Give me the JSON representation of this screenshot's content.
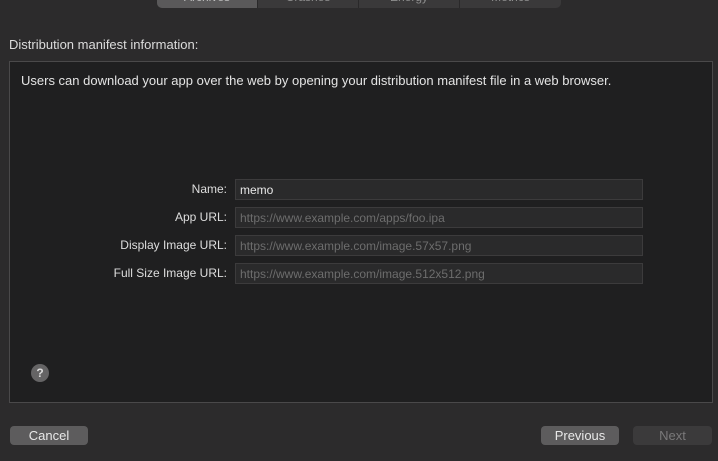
{
  "tabs": [
    {
      "label": "Archives"
    },
    {
      "label": "Crashes"
    },
    {
      "label": "Energy"
    },
    {
      "label": "Metrics"
    }
  ],
  "section_title": "Distribution manifest information:",
  "description": "Users can download your app over the web by opening your distribution manifest file in a web browser.",
  "form": {
    "name": {
      "label": "Name:",
      "value": "memo",
      "placeholder": ""
    },
    "app_url": {
      "label": "App URL:",
      "value": "",
      "placeholder": "https://www.example.com/apps/foo.ipa"
    },
    "display_image_url": {
      "label": "Display Image URL:",
      "value": "",
      "placeholder": "https://www.example.com/image.57x57.png"
    },
    "full_size_image_url": {
      "label": "Full Size Image URL:",
      "value": "",
      "placeholder": "https://www.example.com/image.512x512.png"
    }
  },
  "help": {
    "label": "?"
  },
  "buttons": {
    "cancel": "Cancel",
    "previous": "Previous",
    "next": "Next"
  }
}
